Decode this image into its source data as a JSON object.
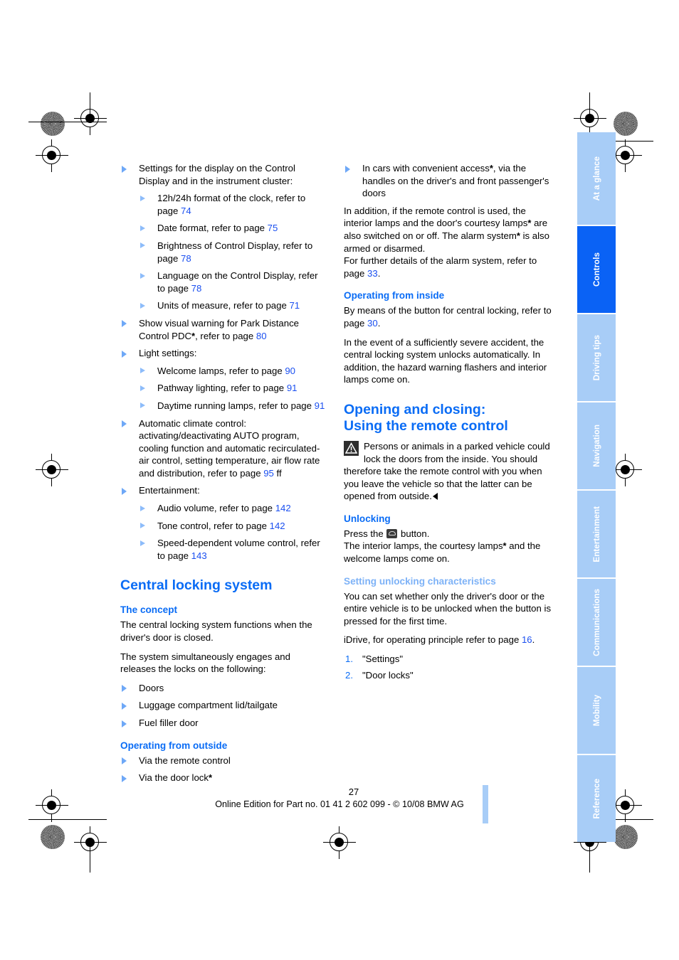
{
  "document": {
    "page_number": "27",
    "footer": "Online Edition for Part no. 01 41 2 602 099 - © 10/08 BMW AG"
  },
  "sidebar": {
    "tabs": [
      {
        "label": "At a glance",
        "active": false
      },
      {
        "label": "Controls",
        "active": true
      },
      {
        "label": "Driving tips",
        "active": false
      },
      {
        "label": "Navigation",
        "active": false
      },
      {
        "label": "Entertainment",
        "active": false
      },
      {
        "label": "Communications",
        "active": false
      },
      {
        "label": "Mobility",
        "active": false
      },
      {
        "label": "Reference",
        "active": false
      }
    ],
    "active_color": "#0a62f5",
    "inactive_color": "#a8cdf7"
  },
  "left_column": {
    "bullet_settings_display": "Settings for the display on the Control Display and in the instrument cluster:",
    "sub_clock": "12h/24h format of the clock, refer to page ",
    "sub_clock_page": "74",
    "sub_date": "Date format, refer to page ",
    "sub_date_page": "75",
    "sub_brightness": "Brightness of Control Display, refer to page ",
    "sub_brightness_page": "78",
    "sub_language": "Language on the Control Display, refer to page ",
    "sub_language_page": "78",
    "sub_units": "Units of measure, refer to page ",
    "sub_units_page": "71",
    "bullet_pdc_a": "Show visual warning for Park Distance Control PDC",
    "bullet_pdc_b": ", refer to page ",
    "bullet_pdc_page": "80",
    "bullet_light_settings": "Light settings:",
    "sub_welcome": "Welcome lamps, refer to page ",
    "sub_welcome_page": "90",
    "sub_pathway": "Pathway lighting, refer to page ",
    "sub_pathway_page": "91",
    "sub_daytime": "Daytime running lamps, refer to page ",
    "sub_daytime_page": "91",
    "bullet_climate": "Automatic climate control: activating/deactivating AUTO program, cooling function and automatic recirculated-air control, setting temperature, air flow rate and distribution, refer to page ",
    "bullet_climate_page": "95",
    "bullet_climate_tail": " ff",
    "bullet_entertainment": "Entertainment:",
    "sub_audio": "Audio volume, refer to page ",
    "sub_audio_page": "142",
    "sub_tone": "Tone control, refer to page ",
    "sub_tone_page": "142",
    "sub_speed_volume": "Speed-dependent volume control, refer to page ",
    "sub_speed_volume_page": "143",
    "h1_central_locking": "Central locking system",
    "h2_the_concept": "The concept",
    "p_concept_1": "The central locking system functions when the driver's door is closed.",
    "p_concept_2": "The system simultaneously engages and releases the locks on the following:",
    "bullet_doors": "Doors",
    "bullet_luggage": "Luggage compartment lid/tailgate",
    "bullet_fuel": "Fuel filler door",
    "h2_operating_outside": "Operating from outside",
    "bullet_via_remote": "Via the remote control",
    "bullet_via_door_lock": "Via the door lock"
  },
  "right_column": {
    "bullet_convenient_access_a": "In cars with convenient access",
    "bullet_convenient_access_b": ", via the handles on the driver's and front passenger's doors",
    "p_addition_a": "In addition, if the remote control is used, the interior lamps and the door's courtesy lamps",
    "p_addition_b": " are also switched on or off. The alarm system",
    "p_addition_c": " is also armed or disarmed.",
    "p_alarm_details": "For further details of the alarm system, refer to page ",
    "p_alarm_details_page": "33",
    "p_alarm_details_tail": ".",
    "h2_operating_inside": "Operating from inside",
    "p_button_central_locking": "By means of the button for central locking, refer to page ",
    "p_button_central_locking_page": "30",
    "p_button_central_locking_tail": ".",
    "p_severe_accident": "In the event of a sufficiently severe accident, the central locking system unlocks automatically. In addition, the hazard warning flashers and interior lamps come on.",
    "h1_opening_closing_line1": "Opening and closing:",
    "h1_opening_closing_line2": "Using the remote control",
    "warning_text": "Persons or animals in a parked vehicle could lock the doors from the inside. You should therefore take the remote control with you when you leave the vehicle so that the latter can be opened from outside.",
    "h2_unlocking": "Unlocking",
    "p_press_button_a": "Press the ",
    "p_press_button_b": " button.",
    "p_lamps_a": "The interior lamps, the courtesy lamps",
    "p_lamps_b": " and the welcome lamps come on.",
    "h2_setting_unlocking": "Setting unlocking characteristics",
    "p_you_can_set": "You can set whether only the driver's door or the entire vehicle is to be unlocked when the button is pressed for the first time.",
    "p_idrive": "iDrive, for operating principle refer to page ",
    "p_idrive_page": "16",
    "p_idrive_tail": ".",
    "step_1_num": "1.",
    "step_1": "\"Settings\"",
    "step_2_num": "2.",
    "step_2": "\"Door locks\""
  },
  "symbols": {
    "asterisk": "*",
    "warning_icon": "warning-triangle-icon",
    "remote_unlock_icon": "remote-unlock-button-icon",
    "end_of_warning_mark": "end-of-note-marker"
  }
}
